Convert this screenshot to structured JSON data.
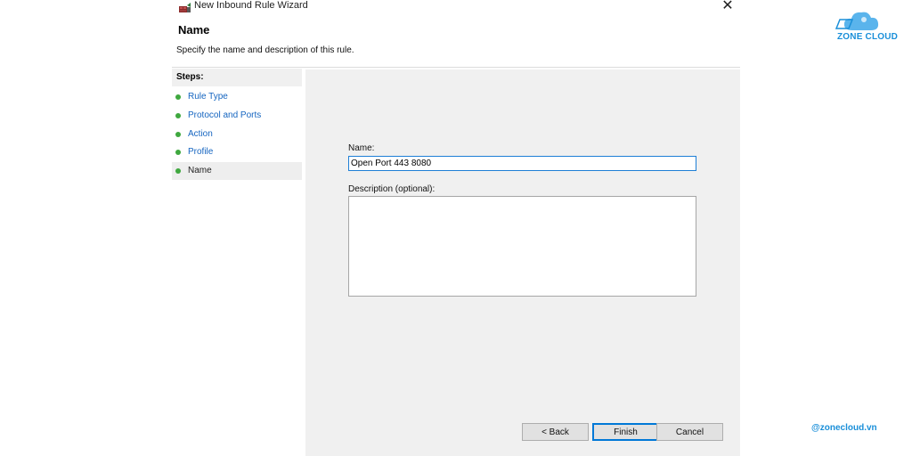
{
  "window": {
    "title": "New Inbound Rule Wizard",
    "close_glyph": "✕",
    "header_title": "Name",
    "header_desc": "Specify the name and description of this rule."
  },
  "steps": {
    "title": "Steps:",
    "items": [
      {
        "label": "Rule Type"
      },
      {
        "label": "Protocol and Ports"
      },
      {
        "label": "Action"
      },
      {
        "label": "Profile"
      },
      {
        "label": "Name"
      }
    ]
  },
  "form": {
    "name_label": "Name:",
    "name_value": "Open Port 443 8080",
    "desc_label": "Description (optional):",
    "desc_value": ""
  },
  "buttons": {
    "back": "< Back",
    "finish": "Finish",
    "cancel": "Cancel"
  },
  "branding": {
    "logo_text": "ZONE CLOUD",
    "handle": "@zonecloud.vn",
    "accent": "#1a8fd9"
  }
}
